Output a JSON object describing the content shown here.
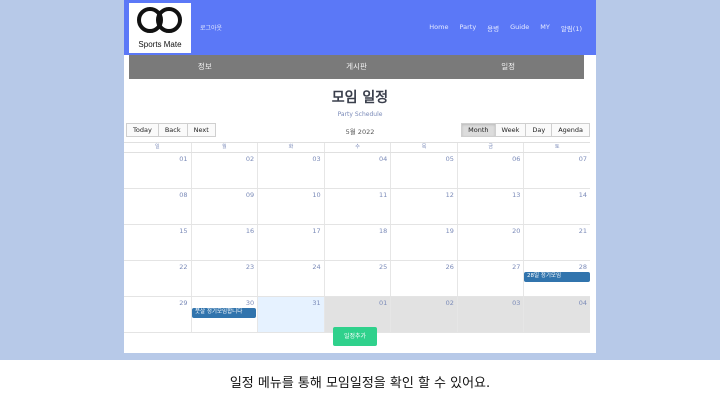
{
  "header": {
    "logo_text": "Sports Mate",
    "logout": "로그아웃",
    "nav": [
      "Home",
      "Party",
      "용병",
      "Guide",
      "MY",
      "알림(1)"
    ]
  },
  "subnav": [
    "정보",
    "게시판",
    "일정"
  ],
  "page": {
    "title": "모임 일정",
    "subtitle": "Party Schedule"
  },
  "toolbar": {
    "today": "Today",
    "back": "Back",
    "next": "Next",
    "period": "5월 2022",
    "views": [
      "Month",
      "Week",
      "Day",
      "Agenda"
    ],
    "active_view": "Month"
  },
  "calendar": {
    "weekdays": [
      "일",
      "월",
      "화",
      "수",
      "목",
      "금",
      "토"
    ],
    "weeks": [
      [
        "01",
        "02",
        "03",
        "04",
        "05",
        "06",
        "07"
      ],
      [
        "08",
        "09",
        "10",
        "11",
        "12",
        "13",
        "14"
      ],
      [
        "15",
        "16",
        "17",
        "18",
        "19",
        "20",
        "21"
      ],
      [
        "22",
        "23",
        "24",
        "25",
        "26",
        "27",
        "28"
      ],
      [
        "29",
        "30",
        "31",
        "01",
        "02",
        "03",
        "04"
      ]
    ],
    "events": [
      {
        "label": "28일 정기모임",
        "week": 3,
        "day": 6
      },
      {
        "label": "풋살 정기모임합니다",
        "week": 4,
        "day": 1
      }
    ]
  },
  "add_button": "일정추가",
  "caption": "일정 메뉴를 통해 모임일정을 확인 할 수 있어요.",
  "colors": {
    "header": "#5b78f7",
    "subnav": "#7a7a7a",
    "event": "#3174ad",
    "add_button": "#2fd18c",
    "background": "#b7c9e8"
  }
}
